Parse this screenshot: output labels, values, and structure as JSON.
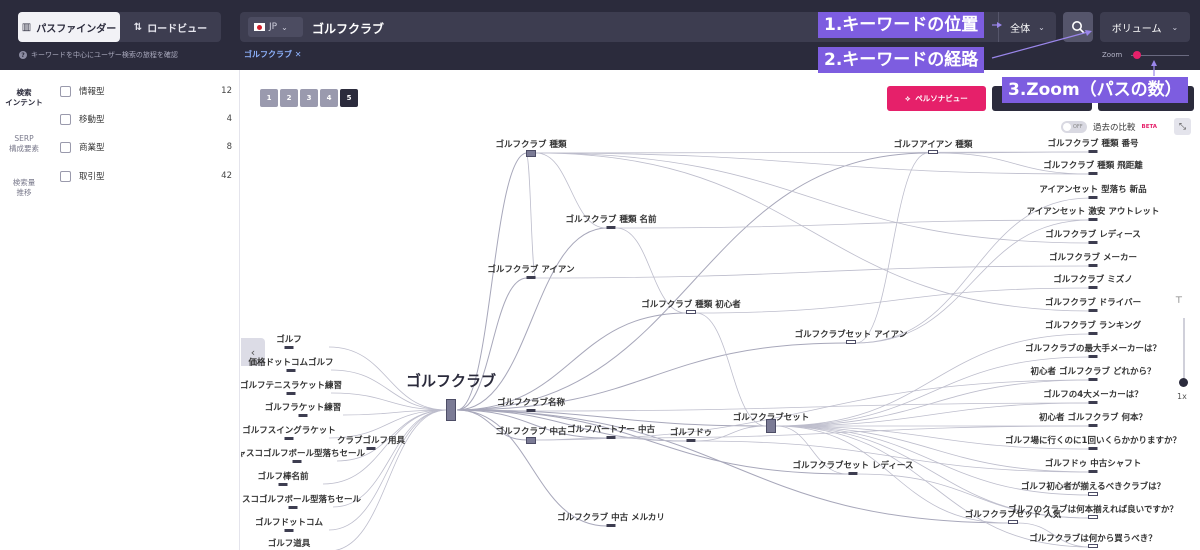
{
  "header": {
    "tabs": [
      {
        "label": "パスファインダー",
        "icon": "map-icon"
      },
      {
        "label": "ロードビュー",
        "icon": "route-icon"
      }
    ],
    "hint": "キーワードを中心にユーザー検索の旅程を確認",
    "country_code": "JP",
    "query": "ゴルフクラブ",
    "scope_label": "全体",
    "metric_label": "ボリューム",
    "chip": "ゴルフクラブ",
    "zoom_label": "Zoom"
  },
  "callouts": [
    "1.キーワードの位置",
    "2.キーワードの経路",
    "3.Zoom（パスの数）"
  ],
  "rail": [
    {
      "label": "検索\nインテント",
      "active": true
    },
    {
      "label": "SERP\n構成要素",
      "active": false
    },
    {
      "label": "検索量\n推移",
      "active": false
    }
  ],
  "filters": [
    {
      "label": "情報型",
      "count": "12"
    },
    {
      "label": "移動型",
      "count": "4"
    },
    {
      "label": "商業型",
      "count": "8"
    },
    {
      "label": "取引型",
      "count": "42"
    }
  ],
  "pagination": [
    "1",
    "2",
    "3",
    "4",
    "5"
  ],
  "active_page": "5",
  "persona_button": "ペルソナビュー",
  "compare": {
    "label": "過去の比較",
    "beta": "BETA",
    "toggle": "OFF"
  },
  "vzoom_label": "1x",
  "graph": {
    "center": "ゴルフクラブ",
    "left_nodes": [
      "ゴルフ",
      "価格ドットコムゴルフ",
      "ゴルフテニスラケット練習",
      "ゴルフラケット練習",
      "ゴルフスイングラケット",
      "キャスコゴルフボール型落ちセール",
      "ゴルフ棒名前",
      "キャスコゴルフボール型落ちセール",
      "ゴルフドットコム",
      "ゴルフ道具"
    ],
    "mid_nodes": [
      "ゴルフクラブ 種類",
      "ゴルフクラブ 種類 名前",
      "ゴルフクラブ アイアン",
      "ゴルフクラブ 種類 初心者",
      "ゴルフクラブ名称",
      "ゴルフクラブ 中古",
      "クラブゴルフ用具",
      "ゴルフパートナー 中古",
      "ゴルフドゥ",
      "ゴルフクラブセット",
      "ゴルフクラブセット アイアン",
      "ゴルフアイアン 種類",
      "ゴルフクラブセット レディース",
      "ゴルフクラブ 中古 メルカリ",
      "ゴルフクラブセット 人気"
    ],
    "right_nodes": [
      "ゴルフクラブ 種類 番号",
      "ゴルフクラブ 種類 飛距離",
      "アイアンセット 型落ち 新品",
      "アイアンセット 激安 アウトレット",
      "ゴルフクラブ レディース",
      "ゴルフクラブ メーカー",
      "ゴルフクラブ ミズノ",
      "ゴルフクラブ ドライバー",
      "ゴルフクラブ ランキング",
      "ゴルフクラブの最大手メーカーは？",
      "初心者 ゴルフクラブ どれから？",
      "ゴルフの4大メーカーは？",
      "初心者 ゴルフクラブ 何本？",
      "ゴルフ場に行くのに1回いくらかかりますか？",
      "ゴルフドゥ 中古シャフト",
      "ゴルフ初心者が揃えるべきクラブは？",
      "ゴルフのクラブは何本揃えれば良いですか？",
      "ゴルフクラブは何から買うべき？"
    ]
  }
}
